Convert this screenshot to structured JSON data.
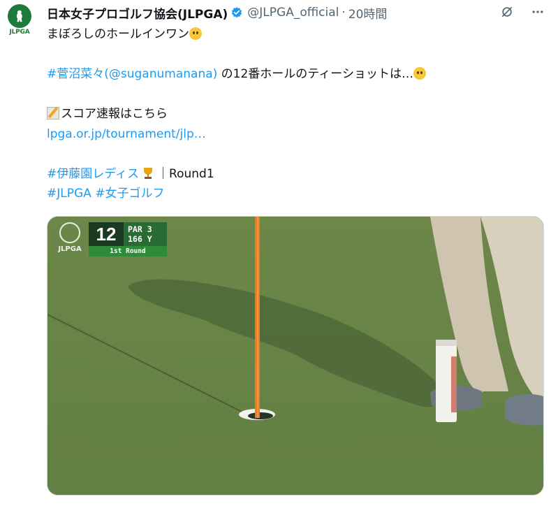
{
  "avatar": {
    "label": "JLPGA",
    "icon": "golfer-logo-icon",
    "color": "#1e7a3a"
  },
  "header": {
    "name": "日本女子プロゴルフ協会(JLPGA)",
    "verified_icon": "verified-badge-icon",
    "handle": "@JLPGA_official",
    "separator": "·",
    "time": "20時間",
    "actions": [
      "grok-icon",
      "more-icon"
    ]
  },
  "tweet": {
    "line1": "まぼろしのホールインワン",
    "hashtag_name": "#菅沼菜々",
    "mention": "(@suganumanana)",
    "line3_rest": " の12番ホールのティーショットは…",
    "score_text": "スコア速報はこちら",
    "url": "lpga.or.jp/tournament/jlp…",
    "hashtag_event": "#伊藤園レディス",
    "round_sep": "｜Round1",
    "hashtag_jlpga": "#JLPGA",
    "hashtag_golf": "#女子ゴルフ"
  },
  "media": {
    "logo_text": "JLPGA",
    "hole_number": "12",
    "par": "PAR 3",
    "yards": "166 Y",
    "round": "1st Round"
  },
  "colors": {
    "link": "#1d9bf0",
    "text": "#0f1419",
    "muted": "#536471"
  }
}
